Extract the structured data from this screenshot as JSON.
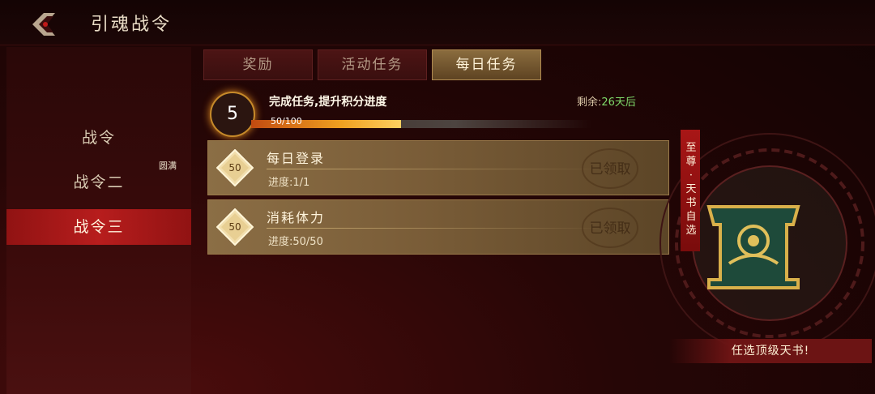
{
  "header": {
    "title": "引魂战令",
    "back_icon": "back-arrow-icon"
  },
  "sidebar": {
    "items": [
      {
        "label": "战令"
      },
      {
        "label": "战令二"
      },
      {
        "label": "战令三"
      }
    ],
    "badge": "圆满"
  },
  "tabs": [
    {
      "label": "奖励"
    },
    {
      "label": "活动任务"
    },
    {
      "label": "每日任务"
    }
  ],
  "progress": {
    "level": "5",
    "label": "完成任务,提升积分进度",
    "remaining_prefix": "剩余:",
    "remaining_days": "26天后",
    "value_text": "50/100",
    "fraction": 0.5
  },
  "tasks": [
    {
      "points": "50",
      "title": "每日登录",
      "progress": "进度:1/1",
      "status": "已领取"
    },
    {
      "points": "50",
      "title": "消耗体力",
      "progress": "进度:50/50",
      "status": "已领取"
    }
  ],
  "reward_panel": {
    "banner_text": "至尊·天书自选",
    "button_label": "任选顶级天书!"
  },
  "colors": {
    "accent_red": "#b01818",
    "gold": "#c68a2a",
    "green_text": "#7fd96a"
  }
}
